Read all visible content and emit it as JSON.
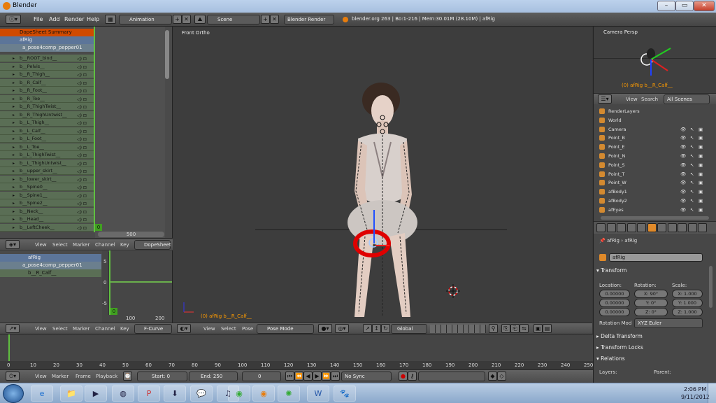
{
  "window": {
    "title": "Blender"
  },
  "topbar": {
    "menus": [
      "File",
      "Add",
      "Render",
      "Help"
    ],
    "screen": "Animation",
    "scene": "Scene",
    "engine": "Blender Render",
    "info": "blender.org 263 | Bo:1-216 | Mem:30.01M (28.10M) | afRig"
  },
  "dopesheet": {
    "summary": "DopeSheet Summary",
    "object": "afRig",
    "action": "a_pose4comp_pepper01",
    "bones": [
      "b__ROOT_bind__",
      "b__Pelvis__",
      "b__R_Thigh__",
      "b__R_Calf__",
      "b__R_Foot__",
      "b__R_Toe__",
      "b__R_ThighTwist__",
      "b__R_ThighUntwist__",
      "b__L_Thigh__",
      "b__L_Calf__",
      "b__L_Foot__",
      "b__L_Toe__",
      "b__L_ThighTwist__",
      "b__L_ThighUntwist__",
      "b__upper_skirt__",
      "b__lower_skirt__",
      "b__Spine0__",
      "b__Spine1__",
      "b__Spine2__",
      "b__Neck__",
      "b__Head__",
      "b__LeftCheek__"
    ],
    "frame_marker": "0",
    "scroll_value": "500",
    "header": [
      "View",
      "Select",
      "Marker",
      "Channel",
      "Key"
    ],
    "mode": "DopeSheet"
  },
  "fcurve": {
    "object": "afRig",
    "action": "a_pose4comp_pepper01",
    "bone": "b__R_Calf__",
    "y_ticks": [
      "5",
      "0",
      "-5"
    ],
    "x_ticks": [
      "100",
      "200"
    ],
    "frame_marker": "0",
    "header": [
      "View",
      "Select",
      "Marker",
      "Channel",
      "Key"
    ],
    "mode": "F-Curve Edit"
  },
  "viewport": {
    "label": "Front Ortho",
    "selection": "(0) afRig b__R_Calf__",
    "header": [
      "View",
      "Select",
      "Pose"
    ],
    "mode": "Pose Mode",
    "orientation": "Global"
  },
  "camera_view": {
    "label": "Camera Persp",
    "selection": "(0) afRig b__R_Calf__"
  },
  "outliner": {
    "header": [
      "View",
      "Search"
    ],
    "filter": "All Scenes",
    "items": [
      "RenderLayers",
      "World",
      "Camera",
      "Point_B",
      "Point_E",
      "Point_N",
      "Point_S",
      "Point_T",
      "Point_W",
      "afBody1",
      "afBody2",
      "afEyes"
    ]
  },
  "properties": {
    "breadcrumb_1": "afRig",
    "breadcrumb_2": "afRig",
    "name": "afRig",
    "transform": "Transform",
    "location_label": "Location:",
    "rotation_label": "Rotation:",
    "scale_label": "Scale:",
    "location": [
      "0.00000",
      "0.00000",
      "0.00000"
    ],
    "rotation": [
      "X: 90°",
      "Y: 0°",
      "Z: 0°"
    ],
    "scale": [
      "X: 1.000",
      "Y: 1.000",
      "Z: 1.000"
    ],
    "rotation_mode_label": "Rotation Mod",
    "rotation_mode": "XYZ Euler",
    "panels": [
      "Delta Transform",
      "Transform Locks",
      "Relations"
    ],
    "layers": "Layers:",
    "parent": "Parent:"
  },
  "timeline": {
    "ticks": [
      "0",
      "10",
      "20",
      "30",
      "40",
      "50",
      "60",
      "70",
      "80",
      "90",
      "100",
      "110",
      "120",
      "130",
      "140",
      "150",
      "160",
      "170",
      "180",
      "190",
      "200",
      "210",
      "220",
      "230",
      "240",
      "250"
    ],
    "header": [
      "View",
      "Marker",
      "Frame",
      "Playback"
    ],
    "start": "Start: 0",
    "end": "End: 250",
    "current": "0",
    "sync": "No Sync"
  },
  "taskbar": {
    "time": "2:06 PM",
    "date": "9/11/2012"
  }
}
